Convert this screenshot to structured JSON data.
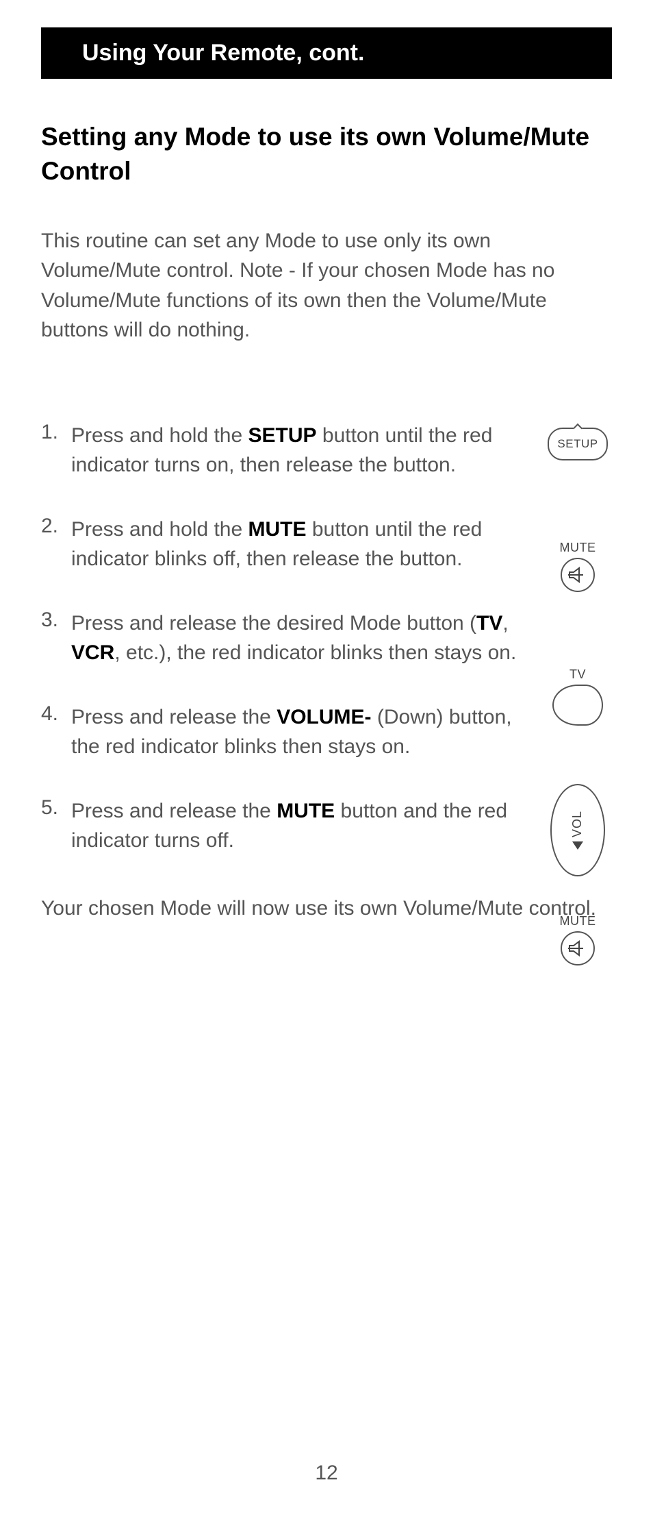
{
  "header": {
    "title": "Using Your Remote, cont."
  },
  "section": {
    "title": "Setting any Mode to use its own Volume/Mute Control",
    "intro": "This routine can set any Mode to use only its own Volume/Mute control. Note - If your chosen Mode has no Volume/Mute functions of its own then the Volume/Mute buttons will do nothing."
  },
  "steps": [
    {
      "num": "1.",
      "pre": "Press and hold the ",
      "bold": "SETUP",
      "post": " button until the red indicator turns on, then release the button.",
      "icon_label": "SETUP",
      "icon_type": "setup"
    },
    {
      "num": "2.",
      "pre": "Press and hold the ",
      "bold": "MUTE",
      "post": " button until the red indicator blinks off, then release the button.",
      "icon_label": "MUTE",
      "icon_type": "mute"
    },
    {
      "num": "3.",
      "pre": "Press and release the desired Mode button (",
      "bold": "TV",
      "mid": ", ",
      "bold2": "VCR",
      "post": ", etc.), the red indicator blinks then stays on.",
      "icon_label": "TV",
      "icon_type": "tv"
    },
    {
      "num": "4.",
      "pre": "Press and release the ",
      "bold": "VOLUME-",
      "post": " (Down) button, the red indicator blinks then stays on.",
      "icon_label": "VOL",
      "icon_type": "vol"
    },
    {
      "num": "5.",
      "pre": "Press and release the ",
      "bold": "MUTE",
      "post": " button and the red indicator turns off.",
      "icon_label": "MUTE",
      "icon_type": "mute"
    }
  ],
  "closing": "Your chosen Mode will now use its own Volume/Mute control.",
  "page_number": "12"
}
